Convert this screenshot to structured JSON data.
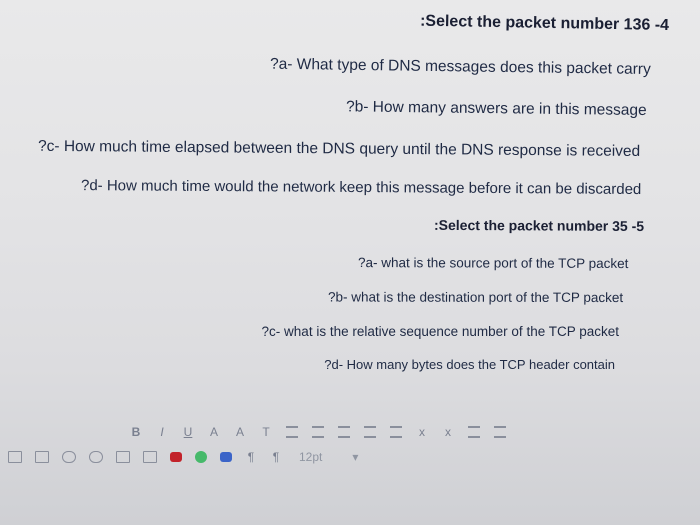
{
  "questions": {
    "q4_title": ":Select the packet number 136 -4",
    "q4_a": "?a- What type of DNS messages does this packet carry",
    "q4_b": "?b- How many answers are in this message",
    "q4_c": "?c- How much time elapsed between the DNS query until the DNS response is received",
    "q4_d": "?d- How much time would the network keep this message before it can be discarded",
    "q5_title": ":Select the packet number 35 -5",
    "q5_a": "?a- what is the source port of the TCP packet",
    "q5_b": "?b- what is the destination port of the TCP packet",
    "q5_c": "?c- what is the relative sequence number of the TCP packet",
    "q5_d": "?d- How many bytes does the TCP header contain"
  },
  "toolbar": {
    "bold": "B",
    "italic": "I",
    "underline": "U",
    "font_color": "A",
    "highlight": "A",
    "clear_format": "T",
    "superscript": "x",
    "subscript": "x",
    "paragraph": "¶",
    "font_size": "12pt",
    "dropdown_caret": "▾"
  }
}
